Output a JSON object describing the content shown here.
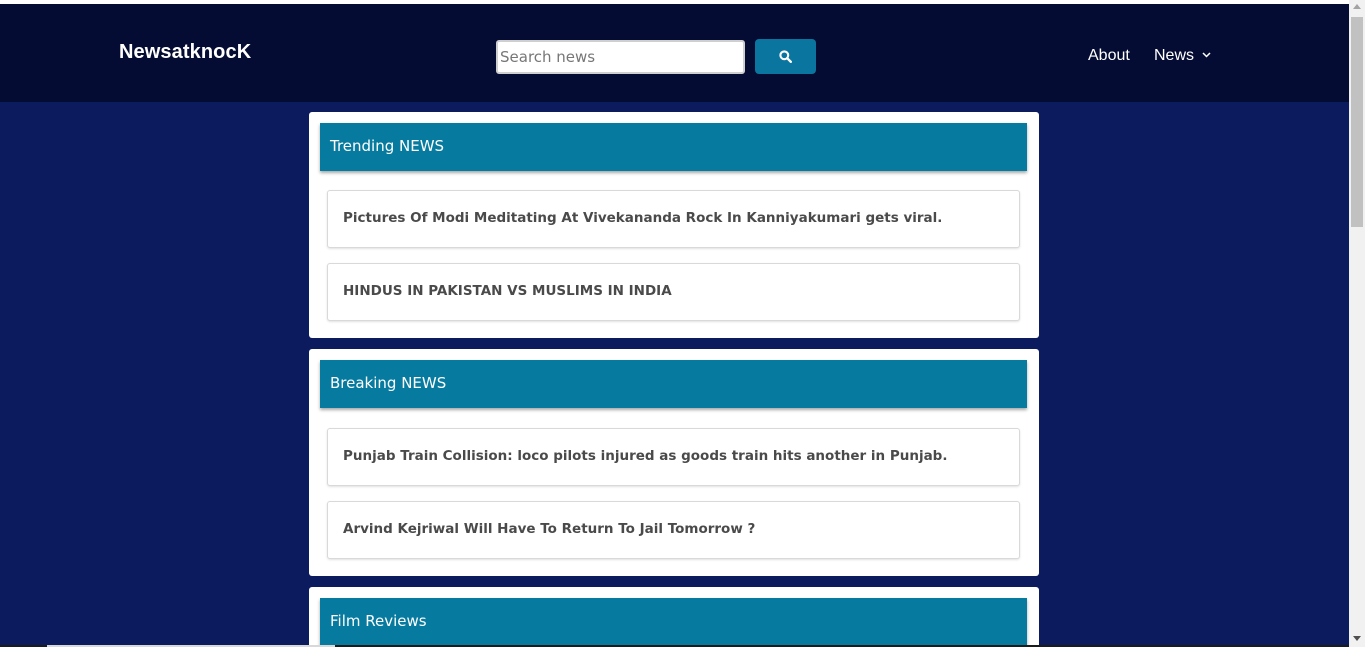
{
  "header": {
    "brand": "NewsatknocK",
    "search": {
      "placeholder": "Search news",
      "value": ""
    },
    "search_button_icon": "search-icon",
    "nav": {
      "about_label": "About",
      "news_label": "News",
      "news_icon": "chevron-down-icon"
    }
  },
  "sections": [
    {
      "title": "Trending NEWS",
      "items": [
        "Pictures Of Modi Meditating At Vivekananda Rock In Kanniyakumari gets viral.",
        "HINDUS IN PAKISTAN VS MUSLIMS IN INDIA"
      ]
    },
    {
      "title": "Breaking NEWS",
      "items": [
        "Punjab Train Collision: loco pilots injured as goods train hits another in Punjab.",
        "Arvind Kejriwal Will Have To Return To Jail Tomorrow ?"
      ]
    },
    {
      "title": "Film Reviews",
      "items": []
    }
  ],
  "colors": {
    "navbar": "#050c33",
    "page_background": "#0c1a5e",
    "section_header": "#077a9f",
    "search_button": "#0a76a0"
  }
}
